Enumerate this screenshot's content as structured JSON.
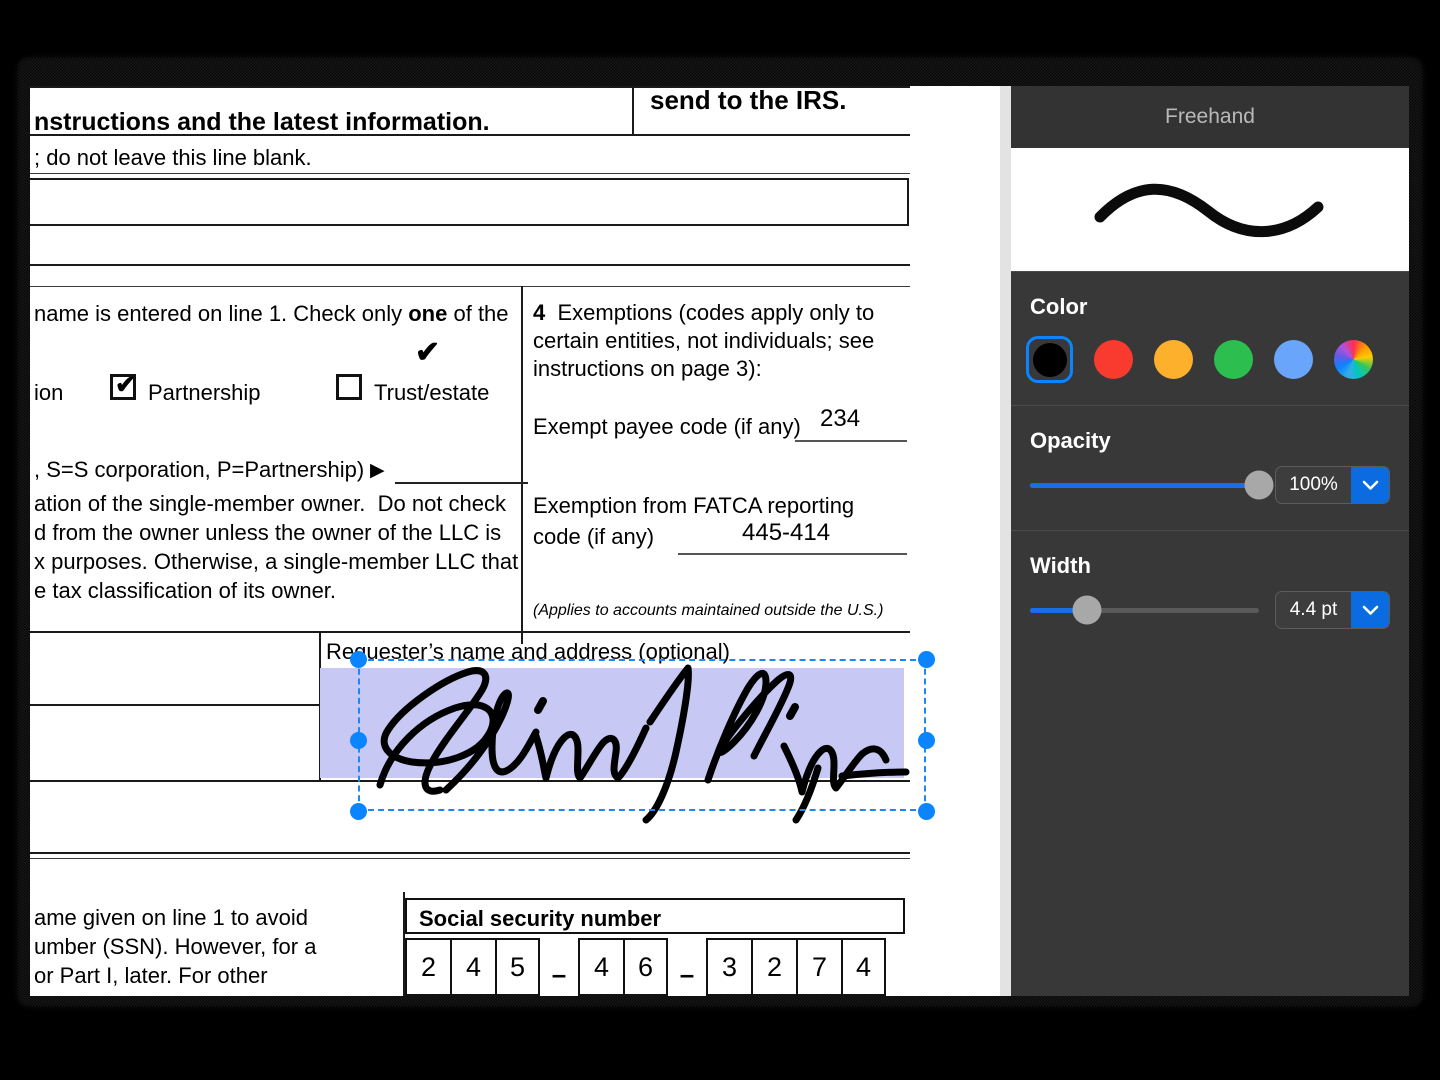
{
  "document": {
    "header_left": "nstructions and the latest information.",
    "header_right": "send to the IRS.",
    "line_blank_note": "; do not leave this line blank.",
    "line3_intro": "name is entered on line 1. Check only",
    "line3_bold": "one",
    "line3_tail": "of the",
    "checkbox_partial_label": "ion",
    "checkbox_partnership": "Partnership",
    "checkbox_trust": "Trust/estate",
    "llc_codes_line": ", S=S corporation, P=Partnership)",
    "llc_note_1": "ation of the single-member owner.  Do not check",
    "llc_note_2": "d from the owner unless the owner of the LLC is",
    "llc_note_3": "x purposes. Otherwise, a single-member LLC that",
    "llc_note_4": "e tax classification of its owner.",
    "exemptions_heading_num": "4",
    "exemptions_heading_text": "Exemptions (codes apply only to certain entities, not individuals; see instructions on page 3):",
    "exempt_payee_label": "Exempt payee code (if any)",
    "exempt_payee_value": "234",
    "fatca_label_line1": "Exemption from FATCA reporting",
    "fatca_label_line2": "code (if any)",
    "fatca_value": "445-414",
    "fatca_note": "(Applies to accounts maintained outside the U.S.)",
    "requester_label": "Requester’s name and address (optional)",
    "ssn_note_1": "ame given on line 1 to avoid",
    "ssn_note_2": "umber (SSN). However, for a",
    "ssn_note_3": "or Part I, later. For other",
    "ssn_title": "Social security number",
    "ssn_digits": [
      "2",
      "4",
      "5",
      "4",
      "6",
      "3",
      "2",
      "7",
      "4"
    ],
    "ssn_dash": "–",
    "freehand_checkmark": "✔",
    "checked_tick": "✔"
  },
  "panel": {
    "title": "Freehand",
    "preview_name": "freehand-stroke-preview",
    "color": {
      "label": "Color",
      "selected_hex": "#000000",
      "swatches": [
        {
          "name": "black",
          "hex": "#000000",
          "selected": true
        },
        {
          "name": "red",
          "hex": "#f93a2f",
          "selected": false
        },
        {
          "name": "orange",
          "hex": "#fcb02c",
          "selected": false
        },
        {
          "name": "green",
          "hex": "#2cbe4e",
          "selected": false
        },
        {
          "name": "blue",
          "hex": "#69a6fb",
          "selected": false
        },
        {
          "name": "color-wheel",
          "hex": "wheel",
          "selected": false
        }
      ]
    },
    "opacity": {
      "label": "Opacity",
      "value": "100%",
      "percent": 100
    },
    "width": {
      "label": "Width",
      "value": "4.4 pt",
      "percent": 17
    },
    "caret_glyph": "⌄",
    "accent_hex": "#0a84ff"
  }
}
